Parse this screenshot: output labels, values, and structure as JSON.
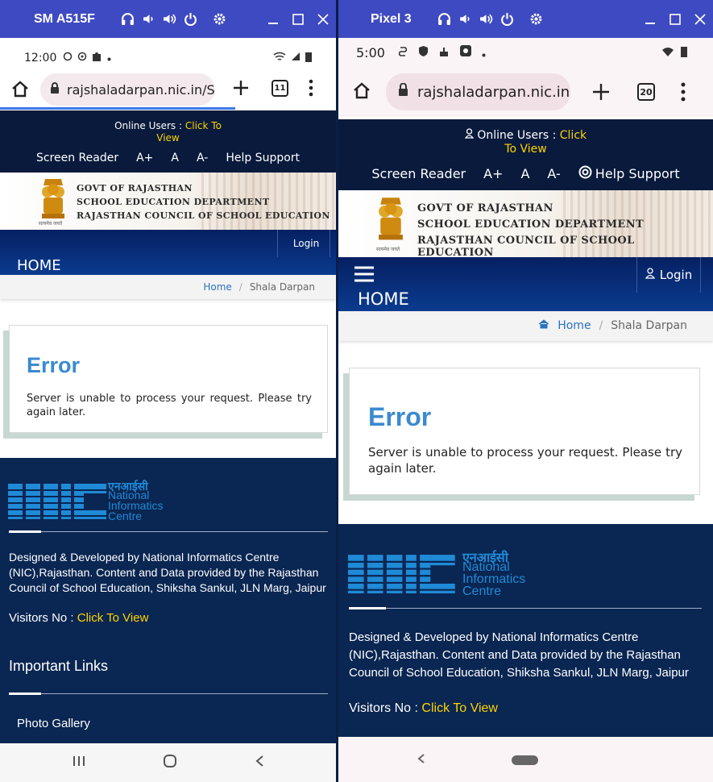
{
  "colors": {
    "titlebar": "#3e4ac1",
    "site_dark": "#0a1a3c",
    "nav_blue": "#0a3b8f",
    "footer": "#0a2652",
    "link_yellow": "#ffd400",
    "error_blue": "#3b8ad0"
  },
  "deviceA": {
    "name": "SM A515F",
    "status_time": "12:00",
    "url": "rajshaladarpan.nic.in/S",
    "tab_count": "11",
    "site": {
      "online_users_label": "Online Users :",
      "click_to": "Click To",
      "view": "View",
      "icon_glyph": "",
      "screen_reader": "Screen Reader",
      "a_plus": "A+",
      "a": "A",
      "a_minus": "A-",
      "help_support": "Help Support",
      "banner_line1": "GOVT OF RAJASTHAN",
      "banner_line2": "SCHOOL EDUCATION DEPARTMENT",
      "banner_line3": "RAJASTHAN COUNCIL OF SCHOOL EDUCATION",
      "emblem_motto": "सत्यमेव जयते",
      "login_label": "Login",
      "home_heading": "HOME",
      "crumb_home": "Home",
      "crumb_sep": "/",
      "crumb_current": "Shala Darpan",
      "error_title": "Error",
      "error_message": "Server is unable to process your request. Please try again later.",
      "nic_hindi": "एनआईसी",
      "nic_line1": "National",
      "nic_line2": "Informatics",
      "nic_line3": "Centre",
      "footer_credit": "Designed & Developed by National Informatics Centre (NIC),Rajasthan. Content and Data provided by the Rajasthan Council of School Education, Shiksha Sankul, JLN Marg, Jaipur",
      "visitors_label": "Visitors No :",
      "visitors_link": "Click To View",
      "important_links": "Important Links",
      "photo_gallery": "Photo Gallery"
    }
  },
  "deviceB": {
    "name": "Pixel 3",
    "status_time": "5:00",
    "url": "rajshaladarpan.nic.in/",
    "tab_count": "20",
    "site": {
      "online_users_label": "Online Users :",
      "click_to": "Click",
      "view": "To View",
      "screen_reader": "Screen Reader",
      "a_plus": "A+",
      "a": "A",
      "a_minus": "A-",
      "help_support": "Help Support",
      "banner_line1": "GOVT OF RAJASTHAN",
      "banner_line2": "SCHOOL EDUCATION DEPARTMENT",
      "banner_line3": "RAJASTHAN COUNCIL OF SCHOOL EDUCATION",
      "emblem_motto": "सत्यमेव जयते",
      "login_label": "Login",
      "home_heading": "HOME",
      "crumb_home": "Home",
      "crumb_sep": "/",
      "crumb_current": "Shala Darpan",
      "error_title": "Error",
      "error_message": "Server is unable to process your request. Please try again later.",
      "nic_hindi": "एनआईसी",
      "nic_line1": "National",
      "nic_line2": "Informatics",
      "nic_line3": "Centre",
      "footer_credit": "Designed & Developed by National Informatics Centre (NIC),Rajasthan. Content and Data provided by the Rajasthan Council of School Education, Shiksha Sankul, JLN Marg, Jaipur",
      "visitors_label": "Visitors No :",
      "visitors_link": "Click To View"
    }
  }
}
